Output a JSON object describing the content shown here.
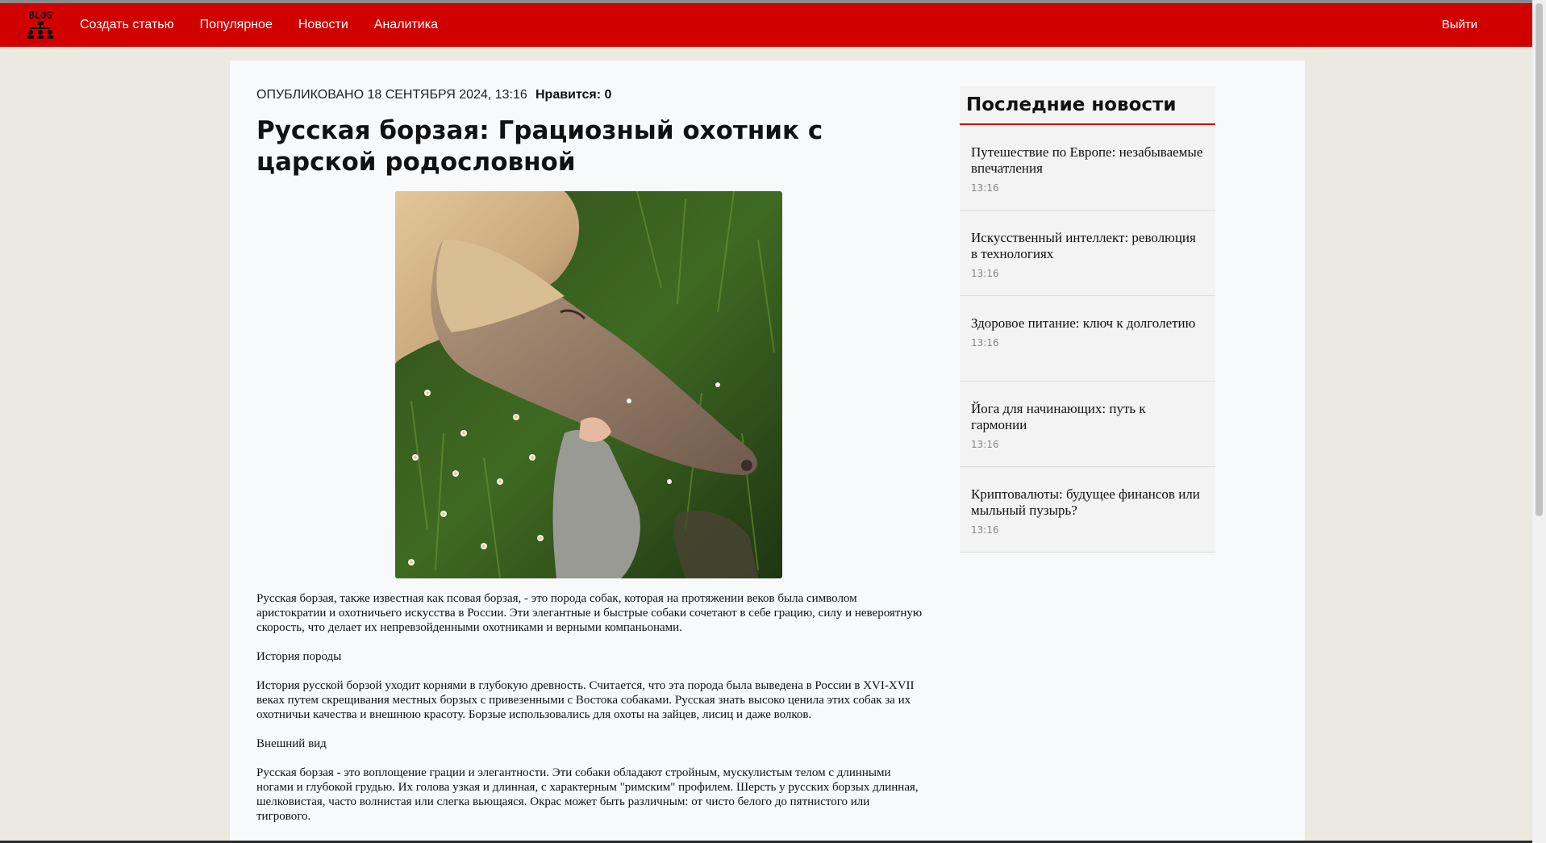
{
  "nav": {
    "logo_text": "BLOG",
    "links": [
      "Создать статью",
      "Популярное",
      "Новости",
      "Аналитика"
    ],
    "logout": "Выйти",
    "accent_color": "#d10000"
  },
  "article": {
    "published": "ОПУБЛИКОВАНО 18 СЕНТЯБРЯ 2024, 13:16",
    "likes": "Нравится: 0",
    "title": "Русская борзая: Грациозный охотник с царской родословной",
    "image_icon": "borzoi-dog-photo",
    "paragraphs": [
      "Русская борзая, также известная как псовая борзая, - это порода собак, которая на протяжении веков была символом аристократии и охотничьего искусства в России. Эти элегантные и быстрые собаки сочетают в себе грацию, силу и невероятную скорость, что делает их непревзойденными охотниками и верными компаньонами.",
      "История породы",
      "История русской борзой уходит корнями в глубокую древность. Считается, что эта порода была выведена в России в XVI-XVII веках путем скрещивания местных борзых с привезенными с Востока собаками. Русская знать высоко ценила этих собак за их охотничьи качества и внешнюю красоту. Борзые использовались для охоты на зайцев, лисиц и даже волков.",
      "Внешний вид",
      "Русская борзая - это воплощение грации и элегантности. Эти собаки обладают стройным, мускулистым телом с длинными ногами и глубокой грудью. Их голова узкая и длинная, с характерным \"римским\" профилем. Шерсть у русских борзых длинная, шелковистая, часто волнистая или слегка вьющаяся. Окрас может быть различным: от чисто белого до пятнистого или тигрового."
    ]
  },
  "sidebar": {
    "title": "Последние новости",
    "items": [
      {
        "title": "Путешествие по Европе: незабываемые впечатления",
        "time": "13:16"
      },
      {
        "title": "Искусственный интеллект: революция в технологиях",
        "time": "13:16"
      },
      {
        "title": "Здоровое питание: ключ к долголетию",
        "time": "13:16"
      },
      {
        "title": "Йога для начинающих: путь к гармонии",
        "time": "13:16"
      },
      {
        "title": "Криптовалюты: будущее финансов или мыльный пузырь?",
        "time": "13:16"
      }
    ]
  }
}
